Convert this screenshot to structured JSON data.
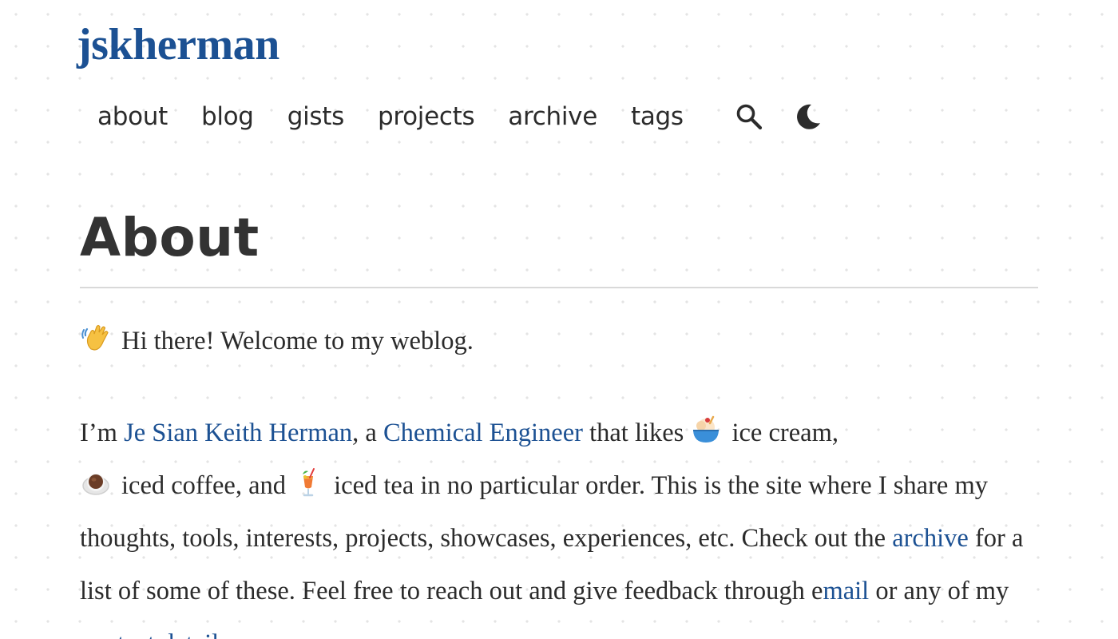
{
  "header": {
    "site_title": "jskherman",
    "nav": [
      {
        "label": "about"
      },
      {
        "label": "blog"
      },
      {
        "label": "gists"
      },
      {
        "label": "projects"
      },
      {
        "label": "archive"
      },
      {
        "label": "tags"
      }
    ],
    "icons": {
      "search": "search-icon",
      "theme_toggle": "moon-icon"
    }
  },
  "main": {
    "title": "About",
    "greeting": {
      "emoji": "waving-hand-icon",
      "text": "Hi there! Welcome to my weblog."
    },
    "intro": {
      "t1": "I’m ",
      "link_name": "Je Sian Keith Herman",
      "t2": ", a ",
      "link_profession": "Chemical Engineer",
      "t3": " that likes ",
      "t4": "ice cream,",
      "t5": "iced coffee, and ",
      "t6": "iced tea in no particular order. This is the site where I share my thoughts, tools, interests, projects, showcases, experiences, etc. Check out the ",
      "link_archive": "archive",
      "t7": " for a list of some of these. Feel free to reach out and give feedback through e",
      "link_email": "mail",
      "t8": " or any of my ",
      "link_contact": "contact details",
      "t9": "."
    }
  },
  "colors": {
    "brand": "#1c5193",
    "text": "#2b2b2b",
    "heading": "#333333",
    "rule": "#d9d9d9"
  }
}
